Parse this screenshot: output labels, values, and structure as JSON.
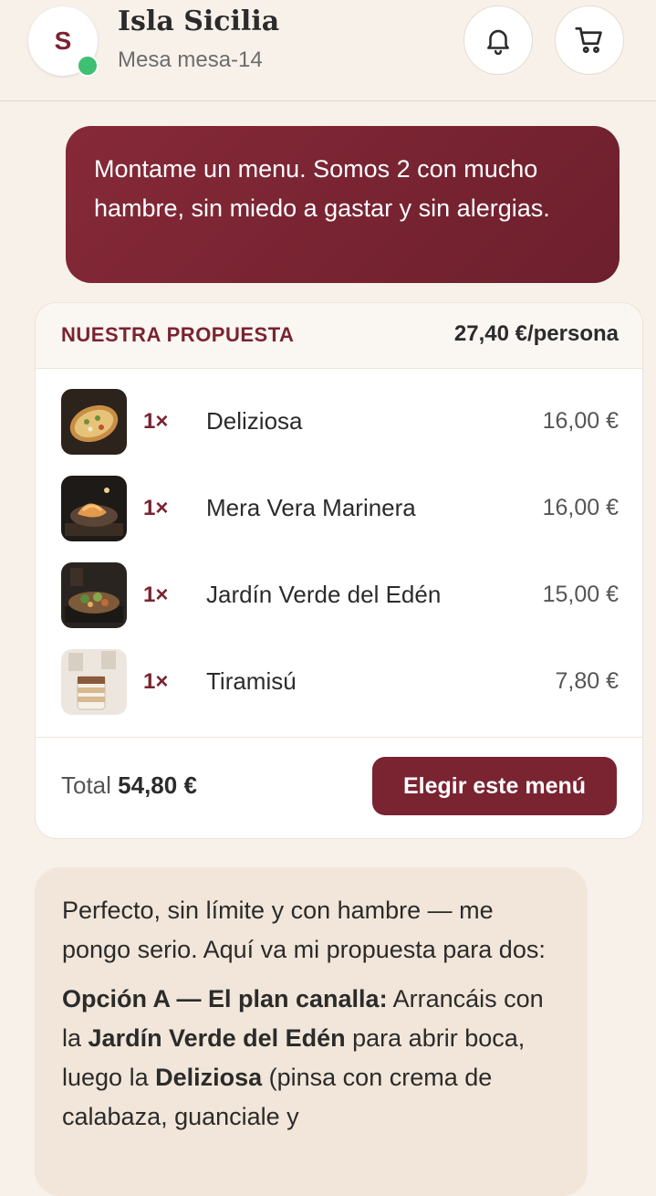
{
  "header": {
    "avatar_letter": "S",
    "restaurant_name": "Isla Sicilia",
    "table_label": "Mesa mesa-14",
    "icons": [
      "bell-icon",
      "cart-icon"
    ],
    "colors": {
      "brand": "#7a2331",
      "online": "#3fbf72"
    }
  },
  "chat": {
    "user_message": "Montame un menu. Somos 2 con mucho hambre, sin miedo a gastar y sin alergias.",
    "assistant": {
      "p1": "Perfecto, sin límite y con hambre — me pongo serio. Aquí va mi propuesta para dos:",
      "option_a_title": "Opción A — El plan canalla:",
      "option_a_t1": " Arrancáis con la ",
      "option_a_b1": "Jardín Verde del Edén",
      "option_a_t2": " para abrir boca, luego la ",
      "option_a_b2": "Deliziosa",
      "option_a_t3": " (pinsa con crema de calabaza, guanciale y"
    }
  },
  "proposal": {
    "title": "NUESTRA PROPUESTA",
    "per_person": "27,40 €/persona",
    "items": [
      {
        "qty": "1×",
        "name": "Deliziosa",
        "price": "16,00 €"
      },
      {
        "qty": "1×",
        "name": "Mera Vera Marinera",
        "price": "16,00 €"
      },
      {
        "qty": "1×",
        "name": "Jardín Verde del Edén",
        "price": "15,00 €"
      },
      {
        "qty": "1×",
        "name": "Tiramisú",
        "price": "7,80 €"
      }
    ],
    "total_label": "Total",
    "total_value": "54,80 €",
    "choose_button": "Elegir este menú"
  }
}
